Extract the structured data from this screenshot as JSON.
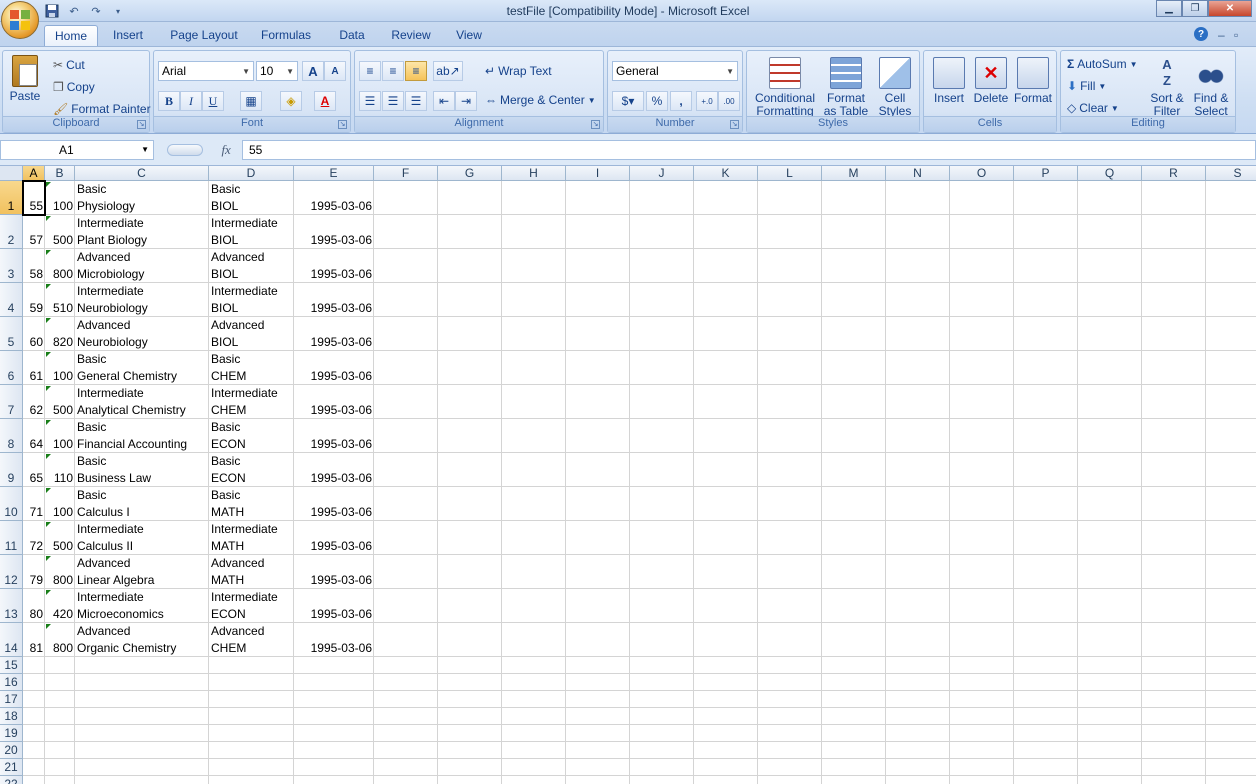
{
  "window": {
    "title": "testFile  [Compatibility Mode] - Microsoft Excel"
  },
  "tabs": [
    "Home",
    "Insert",
    "Page Layout",
    "Formulas",
    "Data",
    "Review",
    "View"
  ],
  "active_tab": "Home",
  "ribbon": {
    "clipboard": {
      "label": "Clipboard",
      "paste": "Paste",
      "cut": "Cut",
      "copy": "Copy",
      "format_painter": "Format Painter"
    },
    "font": {
      "label": "Font",
      "name": "Arial",
      "size": "10",
      "bold": "B",
      "italic": "I",
      "underline": "U",
      "grow": "A",
      "shrink": "A",
      "font_color": "A"
    },
    "alignment": {
      "label": "Alignment",
      "wrap_text": "Wrap Text",
      "merge_center": "Merge & Center"
    },
    "number": {
      "label": "Number",
      "format": "General",
      "percent": "%",
      "comma": ",",
      "inc_decimal": "+.0",
      "dec_decimal": ".00"
    },
    "styles": {
      "label": "Styles",
      "conditional": "Conditional",
      "conditional2": "Formatting",
      "format_table": "Format",
      "format_table2": "as Table",
      "cell_styles": "Cell",
      "cell_styles2": "Styles"
    },
    "cells": {
      "label": "Cells",
      "insert": "Insert",
      "delete": "Delete",
      "format": "Format"
    },
    "editing": {
      "label": "Editing",
      "autosum": "AutoSum",
      "fill": "Fill",
      "clear": "Clear",
      "sort": "Sort &",
      "sort2": "Filter",
      "find": "Find &",
      "find2": "Select"
    }
  },
  "formula_bar": {
    "name_box": "A1",
    "fx": "fx",
    "value": "55"
  },
  "columns": [
    "A",
    "B",
    "C",
    "D",
    "E",
    "F",
    "G",
    "H",
    "I",
    "J",
    "K",
    "L",
    "M",
    "N",
    "O",
    "P",
    "Q",
    "R",
    "S"
  ],
  "selected_cell": "A1",
  "rows": [
    {
      "n": "1",
      "a": "55",
      "b": "100",
      "c1": "Basic",
      "c2": "Physiology",
      "d1": "Basic",
      "d2": "BIOL",
      "e": "1995-03-06"
    },
    {
      "n": "2",
      "a": "57",
      "b": "500",
      "c1": "Intermediate",
      "c2": "Plant Biology",
      "d1": "Intermediate",
      "d2": "BIOL",
      "e": "1995-03-06"
    },
    {
      "n": "3",
      "a": "58",
      "b": "800",
      "c1": "Advanced",
      "c2": "Microbiology",
      "d1": "Advanced",
      "d2": "BIOL",
      "e": "1995-03-06"
    },
    {
      "n": "4",
      "a": "59",
      "b": "510",
      "c1": "Intermediate",
      "c2": "Neurobiology",
      "d1": "Intermediate",
      "d2": "BIOL",
      "e": "1995-03-06"
    },
    {
      "n": "5",
      "a": "60",
      "b": "820",
      "c1": "Advanced",
      "c2": "Neurobiology",
      "d1": "Advanced",
      "d2": "BIOL",
      "e": "1995-03-06"
    },
    {
      "n": "6",
      "a": "61",
      "b": "100",
      "c1": "Basic",
      "c2": "General Chemistry",
      "d1": "Basic",
      "d2": "CHEM",
      "e": "1995-03-06"
    },
    {
      "n": "7",
      "a": "62",
      "b": "500",
      "c1": "Intermediate",
      "c2": "Analytical Chemistry",
      "d1": "Intermediate",
      "d2": "CHEM",
      "e": "1995-03-06"
    },
    {
      "n": "8",
      "a": "64",
      "b": "100",
      "c1": "Basic",
      "c2": "Financial Accounting",
      "d1": "Basic",
      "d2": "ECON",
      "e": "1995-03-06"
    },
    {
      "n": "9",
      "a": "65",
      "b": "110",
      "c1": "Basic",
      "c2": "Business Law",
      "d1": "Basic",
      "d2": "ECON",
      "e": "1995-03-06"
    },
    {
      "n": "10",
      "a": "71",
      "b": "100",
      "c1": "Basic",
      "c2": "Calculus I",
      "d1": "Basic",
      "d2": "MATH",
      "e": "1995-03-06"
    },
    {
      "n": "11",
      "a": "72",
      "b": "500",
      "c1": "Intermediate",
      "c2": "Calculus II",
      "d1": "Intermediate",
      "d2": "MATH",
      "e": "1995-03-06"
    },
    {
      "n": "12",
      "a": "79",
      "b": "800",
      "c1": "Advanced",
      "c2": "Linear Algebra",
      "d1": "Advanced",
      "d2": "MATH",
      "e": "1995-03-06"
    },
    {
      "n": "13",
      "a": "80",
      "b": "420",
      "c1": "Intermediate",
      "c2": "Microeconomics",
      "d1": "Intermediate",
      "d2": "ECON",
      "e": "1995-03-06"
    },
    {
      "n": "14",
      "a": "81",
      "b": "800",
      "c1": "Advanced",
      "c2": "Organic Chemistry",
      "d1": "Advanced",
      "d2": "CHEM",
      "e": "1995-03-06"
    }
  ],
  "empty_rows": [
    "15",
    "16",
    "17",
    "18",
    "19",
    "20",
    "21",
    "22"
  ],
  "colors": {
    "accent": "#15428b",
    "selected_header": "#f1c15f",
    "error_marker": "#1a7f1a"
  }
}
